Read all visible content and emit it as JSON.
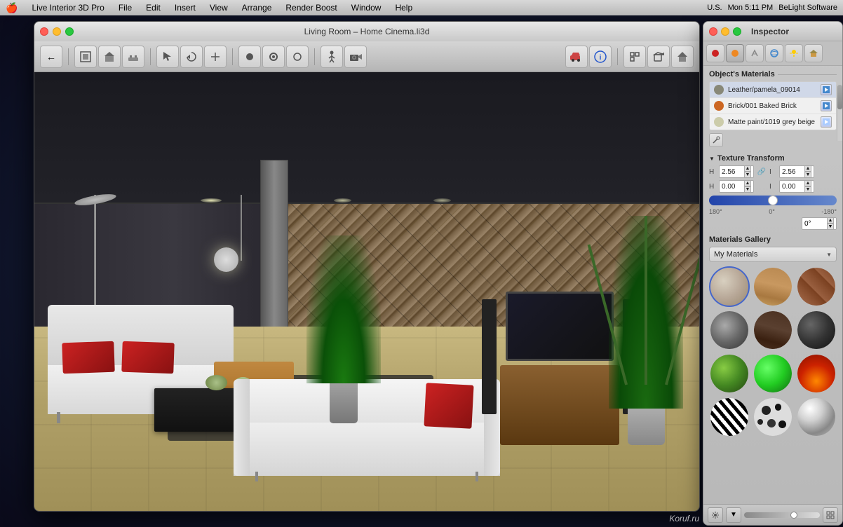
{
  "menubar": {
    "apple": "🍎",
    "items": [
      "Live Interior 3D Pro",
      "File",
      "Edit",
      "Insert",
      "View",
      "Arrange",
      "Render Boost",
      "Window",
      "Help"
    ],
    "right": {
      "time": "Mon 5:11 PM",
      "brand": "BeLight Software",
      "region": "U.S."
    }
  },
  "main_window": {
    "title": "Living Room – Home Cinema.li3d",
    "controls": {
      "close": "close",
      "minimize": "minimize",
      "maximize": "maximize"
    }
  },
  "toolbar": {
    "back_label": "←",
    "tools": [
      "🏠",
      "📦",
      "🪑",
      "↖",
      "↺",
      "⊞",
      "●",
      "◉",
      "◎",
      "🚶",
      "📷"
    ]
  },
  "inspector": {
    "title": "Inspector",
    "tabs": [
      {
        "icon": "🔴",
        "id": "materials",
        "active": false
      },
      {
        "icon": "🟠",
        "id": "texture",
        "active": true
      },
      {
        "icon": "✂️",
        "id": "cut",
        "active": false
      },
      {
        "icon": "🔵",
        "id": "3d",
        "active": false
      },
      {
        "icon": "💡",
        "id": "light",
        "active": false
      },
      {
        "icon": "🏠",
        "id": "home",
        "active": false
      }
    ],
    "objects_materials": {
      "header": "Object's Materials",
      "items": [
        {
          "name": "Leather/pamela_09014",
          "color": "#888878",
          "selected": true
        },
        {
          "name": "Brick/001 Baked Brick",
          "color": "#cc6622"
        },
        {
          "name": "Matte paint/1019 grey beige",
          "color": "#ccccaa"
        }
      ]
    },
    "texture_transform": {
      "header": "Texture Transform",
      "h_value": "2.56",
      "h_label": "H",
      "w_value": "2.56",
      "w_label": "W",
      "x_value": "0.00",
      "x_label": "H",
      "y_value": "0.00",
      "y_label": "I",
      "angle_left": "180°",
      "angle_center": "0°",
      "angle_right": "-180°",
      "angle_value": "0°"
    },
    "gallery": {
      "header": "Materials Gallery",
      "dropdown_value": "My Materials",
      "items": [
        {
          "id": "leather",
          "class": "mat-leather"
        },
        {
          "id": "wood1",
          "class": "mat-wood1"
        },
        {
          "id": "brick",
          "class": "mat-brick"
        },
        {
          "id": "stone1",
          "class": "mat-stone1"
        },
        {
          "id": "dark-wood",
          "class": "mat-dark-wood"
        },
        {
          "id": "dark-stone",
          "class": "mat-dark-stone"
        },
        {
          "id": "green",
          "class": "mat-green"
        },
        {
          "id": "green2",
          "class": "mat-green2"
        },
        {
          "id": "fire",
          "class": "mat-fire"
        },
        {
          "id": "zebra",
          "class": "mat-zebra"
        },
        {
          "id": "spots",
          "class": "mat-spots"
        },
        {
          "id": "chrome",
          "class": "mat-chrome"
        }
      ]
    }
  },
  "watermark": "Koruf.ru"
}
